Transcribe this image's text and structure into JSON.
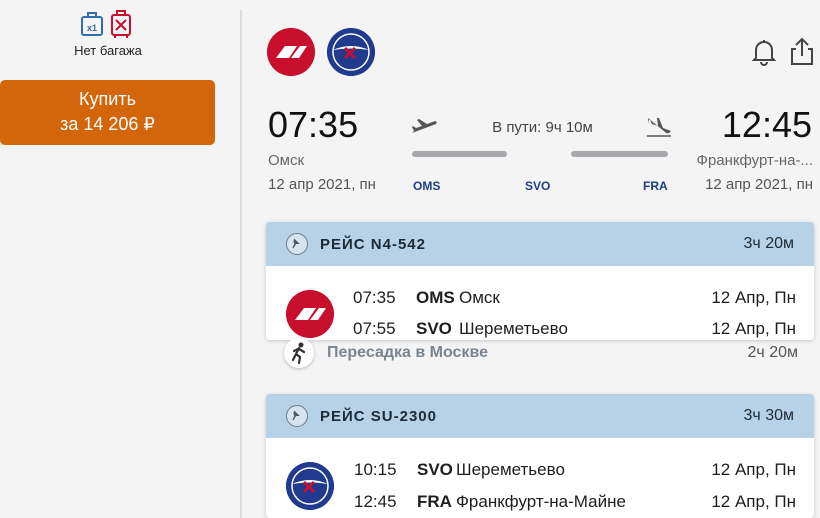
{
  "sidebar": {
    "baggage_label": "Нет багажа",
    "bag_count_badge": "x1",
    "buy_button": {
      "line1": "Купить",
      "line2": "за 14 206 ₽"
    }
  },
  "header": {
    "airlines": [
      "Nordwind Airlines",
      "Aeroflot"
    ],
    "icons": [
      "bell-icon",
      "share-icon"
    ]
  },
  "route": {
    "departure": {
      "time": "07:35",
      "city": "Омск",
      "date": "12 апр 2021, пн",
      "code": "OMS"
    },
    "arrival": {
      "time": "12:45",
      "city": "Франкфурт-на-...",
      "date": "12 апр 2021, пн",
      "code": "FRA"
    },
    "transit_code": "SVO",
    "duration": "В пути: 9ч 10м"
  },
  "flights": [
    {
      "number": "РЕЙС N4-542",
      "duration": "3ч 20м",
      "rows": [
        {
          "time": "07:35",
          "code": "OMS",
          "city": "Омск",
          "date": "12 Апр, Пн"
        },
        {
          "time": "07:55",
          "code": "SVO",
          "city": "Шереметьево",
          "date": "12 Апр, Пн"
        }
      ]
    },
    {
      "number": "РЕЙС SU-2300",
      "duration": "3ч 30м",
      "rows": [
        {
          "time": "10:15",
          "code": "SVO",
          "city": "Шереметьево",
          "date": "12 Апр, Пн"
        },
        {
          "time": "12:45",
          "code": "FRA",
          "city": "Франкфурт-на-Майне",
          "date": "12 Апр, Пн"
        }
      ]
    }
  ],
  "transfer": {
    "label": "Пересадка в Москве",
    "duration": "2ч 20м"
  },
  "colors": {
    "buy": "#d3650a",
    "card_header": "#b7d1e6",
    "iata": "#1d3c84"
  }
}
